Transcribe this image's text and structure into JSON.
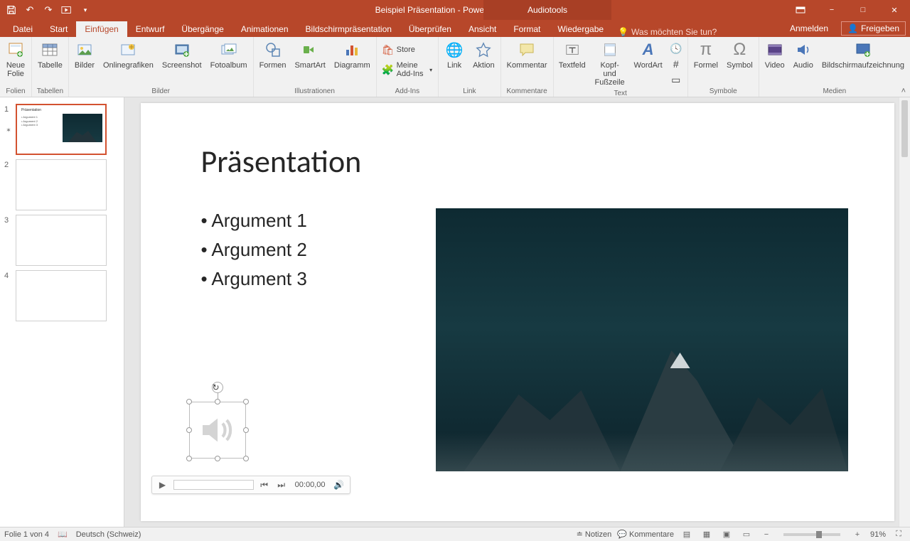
{
  "app": {
    "title": "Beispiel Präsentation - PowerPoint",
    "contextual_tab": "Audiotools"
  },
  "qat": {
    "save": "save",
    "undo": "undo",
    "redo": "redo",
    "start": "start"
  },
  "window_controls": {
    "ribbon_display": "ribbon",
    "minimize": "−",
    "maximize": "□",
    "close": "✕"
  },
  "tabs": {
    "file": "Datei",
    "start": "Start",
    "einfuegen": "Einfügen",
    "entwurf": "Entwurf",
    "uebergaenge": "Übergänge",
    "animationen": "Animationen",
    "bildschirm": "Bildschirmpräsentation",
    "ueberpruefen": "Überprüfen",
    "ansicht": "Ansicht",
    "format": "Format",
    "wiedergabe": "Wiedergabe",
    "anmelden": "Anmelden",
    "freigeben": "Freigeben",
    "tellme": "Was möchten Sie tun?"
  },
  "ribbon": {
    "groups": {
      "folien": "Folien",
      "tabellen": "Tabellen",
      "bilder": "Bilder",
      "illustrationen": "Illustrationen",
      "addins": "Add-Ins",
      "link_g": "Link",
      "kommentare": "Kommentare",
      "text": "Text",
      "symbole": "Symbole",
      "medien": "Medien"
    },
    "buttons": {
      "neue_folie": "Neue\nFolie",
      "tabelle": "Tabelle",
      "bilder": "Bilder",
      "onlinegrafiken": "Onlinegrafiken",
      "screenshot": "Screenshot",
      "fotoalbum": "Fotoalbum",
      "formen": "Formen",
      "smartart": "SmartArt",
      "diagramm": "Diagramm",
      "store": "Store",
      "meine_addins": "Meine Add-Ins",
      "link": "Link",
      "aktion": "Aktion",
      "kommentar": "Kommentar",
      "textfeld": "Textfeld",
      "kopf_fuss": "Kopf- und\nFußzeile",
      "wordart": "WordArt",
      "formel": "Formel",
      "symbol": "Symbol",
      "video": "Video",
      "audio": "Audio",
      "aufzeichnung": "Bildschirmaufzeichnung"
    }
  },
  "thumbnails": {
    "count": 4,
    "nums": [
      "1",
      "2",
      "3",
      "4"
    ]
  },
  "slide": {
    "title": "Präsentation",
    "bullets": [
      "Argument 1",
      "Argument 2",
      "Argument 3"
    ]
  },
  "media": {
    "time": "00:00,00"
  },
  "status": {
    "slide_of": "Folie 1 von 4",
    "lang": "Deutsch (Schweiz)",
    "notizen": "Notizen",
    "kommentare": "Kommentare",
    "zoom": "91%"
  }
}
